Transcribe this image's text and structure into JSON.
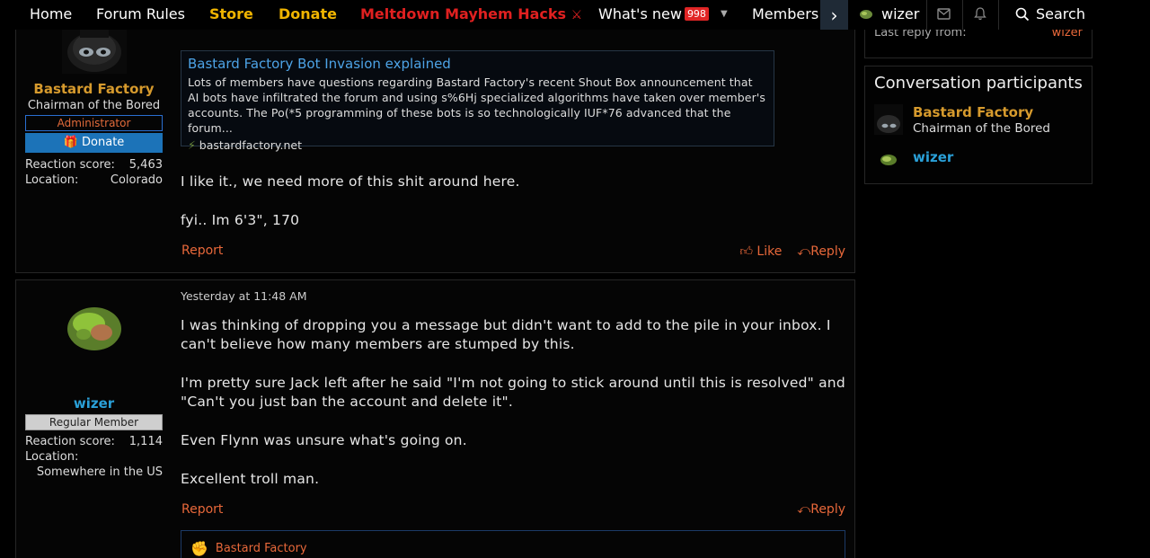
{
  "nav": {
    "home": "Home",
    "rules": "Forum Rules",
    "store": "Store",
    "donate": "Donate",
    "hacks": "Meltdown Mayhem Hacks",
    "whats_new": "What's new",
    "whats_new_count": "998",
    "members": "Members",
    "user": "wizer",
    "search": "Search"
  },
  "post1": {
    "author": "Bastard Factory",
    "title": "Chairman of the Bored",
    "role": "Administrator",
    "donate_label": "Donate",
    "reaction_label": "Reaction score:",
    "reaction_value": "5,463",
    "location_label": "Location:",
    "location_value": "Colorado",
    "unfurl_title": "Bastard Factory Bot Invasion explained",
    "unfurl_desc": "Lots of members have questions regarding Bastard Factory's recent Shout Box announcement that AI bots have infiltrated the forum and using s%6Hj specialized algorithms have taken over member's accounts. The Po(*5 programming of these bots is so technologically IUF*76 advanced that the forum...",
    "unfurl_domain": "bastardfactory.net",
    "body": [
      "I like it., we need more of this shit around here.",
      "fyi.. Im 6'3\", 170"
    ],
    "report": "Report",
    "like": "Like",
    "reply": "Reply"
  },
  "post2": {
    "author": "wizer",
    "role": "Regular Member",
    "reaction_label": "Reaction score:",
    "reaction_value": "1,114",
    "location_label": "Location:",
    "location_value": "Somewhere in the US",
    "timestamp": "Yesterday at 11:48 AM",
    "body": [
      "I was thinking of dropping you a message but didn't want to add to the pile in your inbox. I can't believe how many members are stumped by this.",
      "I'm pretty sure Jack left after he said \"I'm not going to stick around until this is resolved\" and \"Can't you just ban the account and delete it\".",
      "Even Flynn was unsure what's going on.",
      "Excellent troll man."
    ],
    "report": "Report",
    "reply": "Reply",
    "reacted_by": "Bastard Factory"
  },
  "sidebar": {
    "last_reply_label": "Last reply from:",
    "last_reply_user": "wizer",
    "participants_title": "Conversation participants",
    "participants": [
      {
        "name": "Bastard Factory",
        "title": "Chairman of the Bored"
      },
      {
        "name": "wizer",
        "title": ""
      }
    ]
  },
  "colors": {
    "accent_orange": "#e8683a",
    "admin_gold": "#d69a2d",
    "member_blue": "#2aa0d8",
    "link_blue": "#4da3e6",
    "nav_gold": "#f0b400",
    "nav_red": "#e02020"
  }
}
